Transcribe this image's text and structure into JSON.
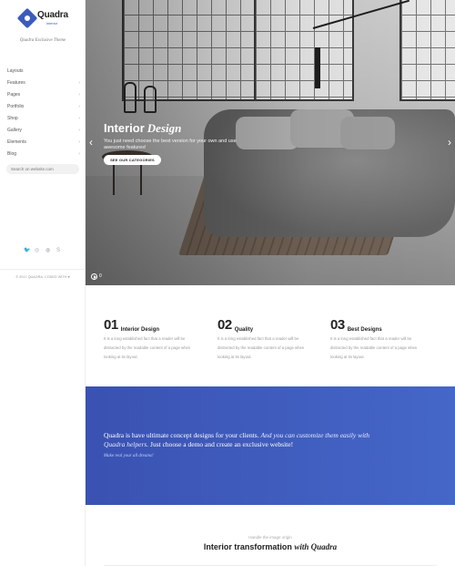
{
  "sidebar": {
    "logo_name": "Quadra",
    "logo_sub": "interior",
    "tagline": "Quadra Exclusive Theme",
    "menu": [
      {
        "label": "Layouts",
        "has_arrow": false
      },
      {
        "label": "Features",
        "has_arrow": true
      },
      {
        "label": "Pages",
        "has_arrow": true
      },
      {
        "label": "Portfolio",
        "has_arrow": true
      },
      {
        "label": "Shop",
        "has_arrow": true
      },
      {
        "label": "Gallery",
        "has_arrow": true
      },
      {
        "label": "Elements",
        "has_arrow": true
      },
      {
        "label": "Blog",
        "has_arrow": true
      }
    ],
    "arrow_glyph": "›",
    "search_placeholder": "Search on website.com",
    "socials": [
      {
        "icon": "twitter-icon",
        "glyph": "🐦"
      },
      {
        "icon": "pinterest-icon",
        "glyph": "◎"
      },
      {
        "icon": "dribbble-icon",
        "glyph": "◍"
      },
      {
        "icon": "skype-icon",
        "glyph": "S"
      }
    ],
    "copyright": "© 2017 QUADRA. CODED WITH ♥"
  },
  "hero": {
    "title_plain": "Interior",
    "title_italic": "Design",
    "text": "You just need choose the best version for your own and use awesome features!",
    "button_label": "SEE OUR CATEGORIES",
    "prev_glyph": "‹",
    "next_glyph": "›",
    "slide_counter": "0"
  },
  "features": [
    {
      "number": "01",
      "title": "Interior Design",
      "text": "It is a long established fact that a reader will be distracted by the readable content of a page when looking at its layout."
    },
    {
      "number": "02",
      "title": "Quality",
      "text": "It is a long established fact that a reader will be distracted by the readable content of a page when looking at its layout."
    },
    {
      "number": "03",
      "title": "Best Designs",
      "text": "It is a long established fact that a reader will be distracted by the readable content of a page when looking at its layout."
    }
  ],
  "banner": {
    "text_plain_1": "Quadra is have ultimate concept designs for your clients. ",
    "text_italic": "And you can customize them easily with Quadra helpers.",
    "text_plain_2": " Just choose a demo and create an exclusive website!",
    "subtext": "Make real your all dreams!"
  },
  "bottom": {
    "subtitle": "Handle the image origin",
    "title_plain": "Interior transformation",
    "title_italic": "with Quadra"
  },
  "colors": {
    "accent": "#3b5bbd",
    "banner_start": "#3a52b2",
    "banner_end": "#4567c8"
  }
}
